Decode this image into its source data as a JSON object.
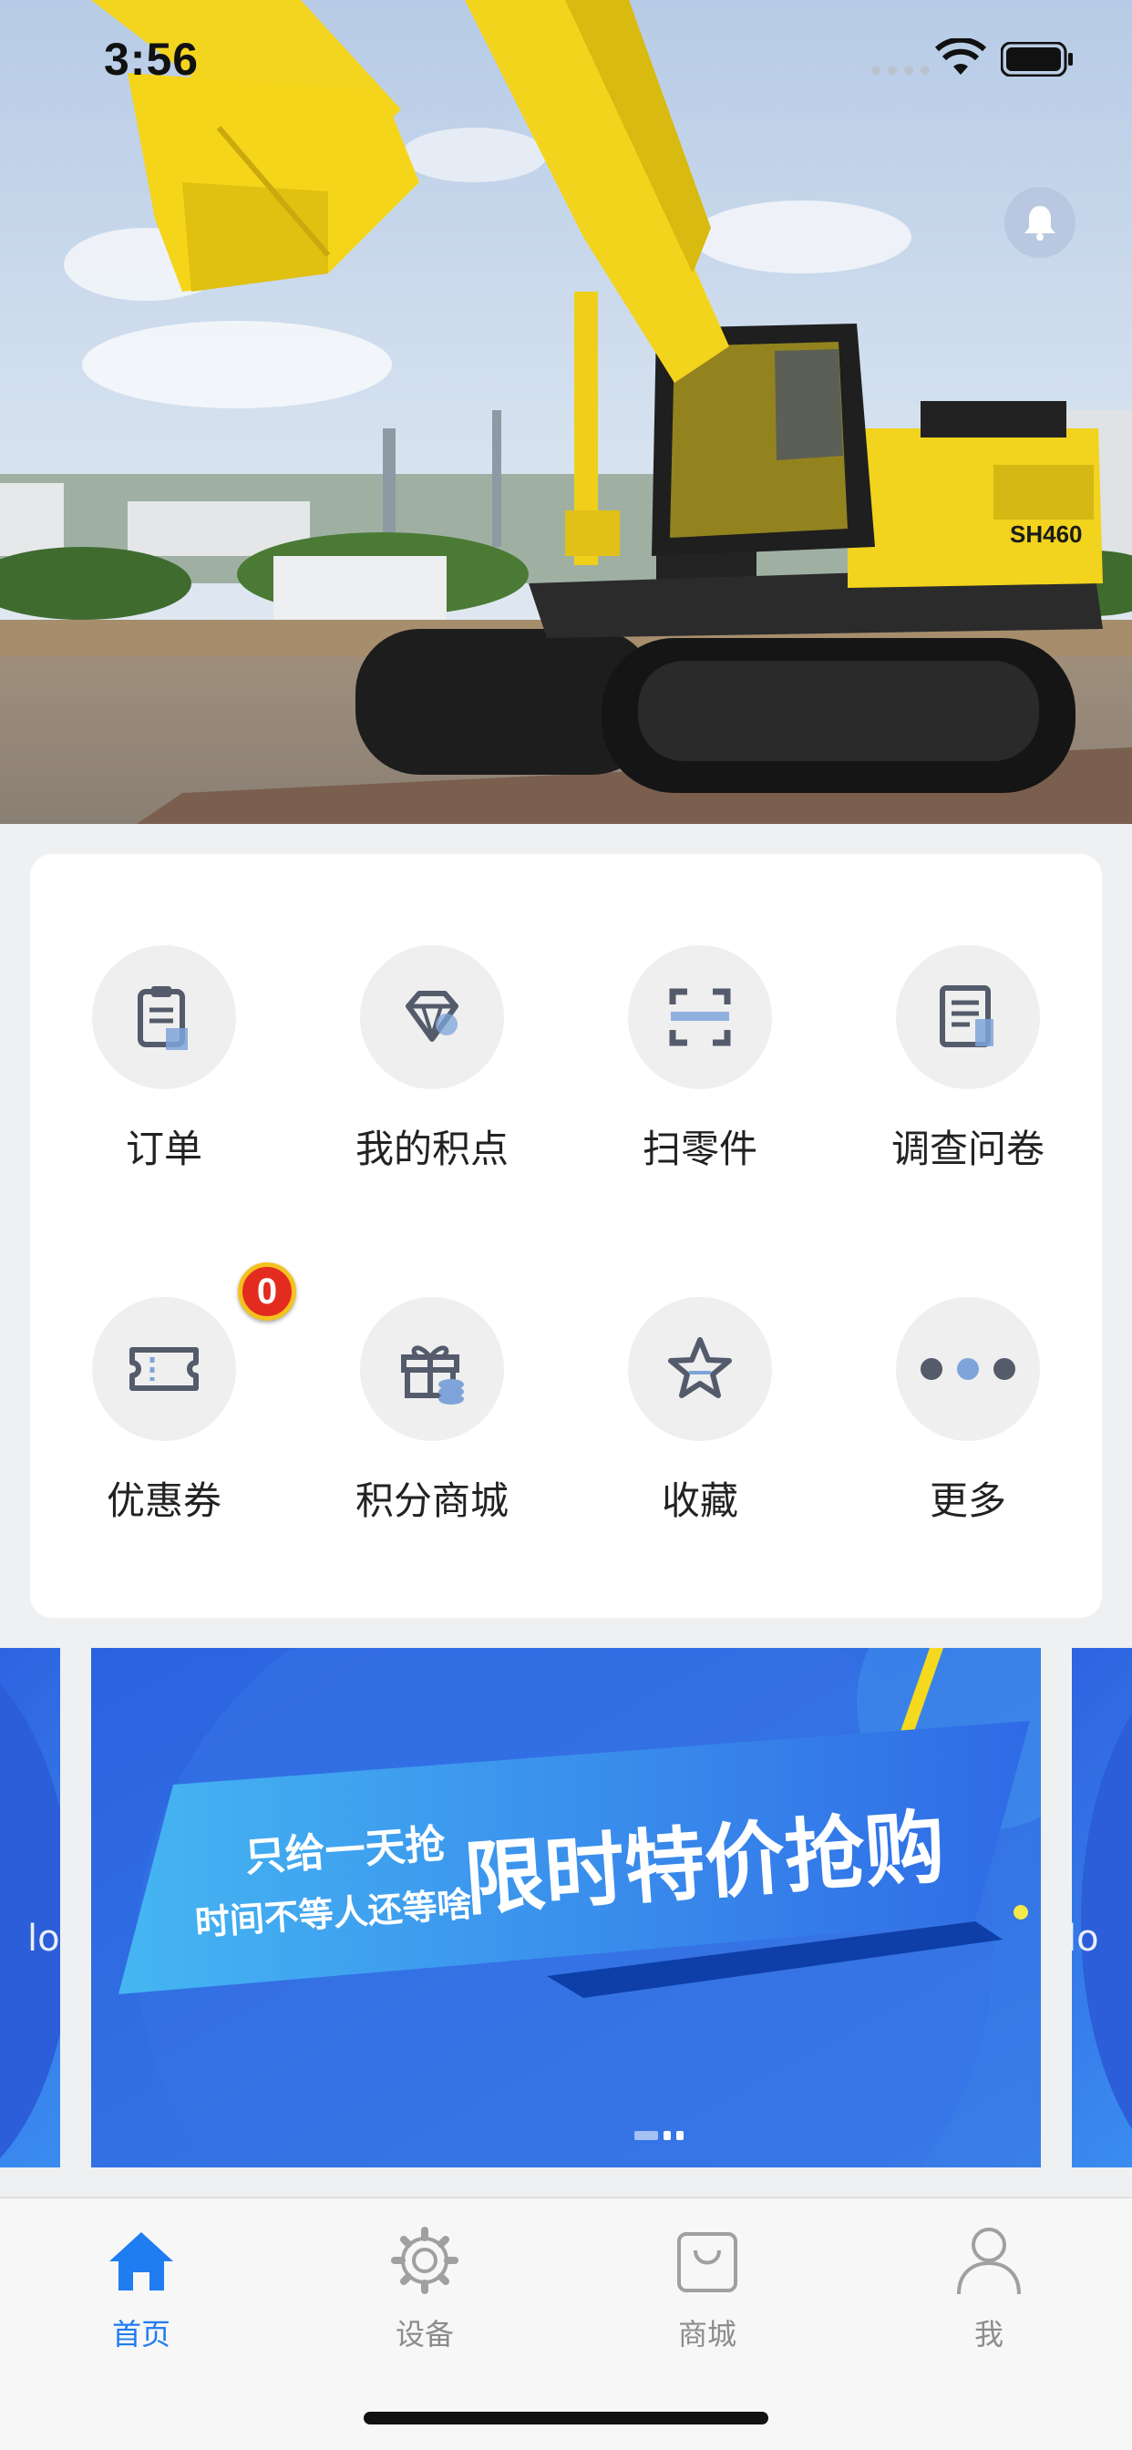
{
  "status_bar": {
    "time": "3:56"
  },
  "header": {
    "bell_icon": "bell-icon"
  },
  "menu": {
    "items": [
      {
        "label": "订单",
        "icon": "order-clipboard-icon"
      },
      {
        "label": "我的积点",
        "icon": "diamond-icon"
      },
      {
        "label": "扫零件",
        "icon": "scan-icon"
      },
      {
        "label": "调查问卷",
        "icon": "questionnaire-icon"
      },
      {
        "label": "优惠券",
        "icon": "coupon-ticket-icon",
        "badge": "0"
      },
      {
        "label": "积分商城",
        "icon": "gift-icon"
      },
      {
        "label": "收藏",
        "icon": "star-icon"
      },
      {
        "label": "更多",
        "icon": "more-dots-icon"
      }
    ]
  },
  "banner": {
    "line1": "只给一天抢",
    "line2": "时间不等人还等啥",
    "headline": "限时特价抢购",
    "accent_color": "#2f63e0"
  },
  "tabbar": {
    "tabs": [
      {
        "label": "首页",
        "icon": "home-icon",
        "active": true
      },
      {
        "label": "设备",
        "icon": "gear-icon",
        "active": false
      },
      {
        "label": "商城",
        "icon": "shopping-bag-icon",
        "active": false
      },
      {
        "label": "我",
        "icon": "person-icon",
        "active": false
      }
    ],
    "active_color": "#1f7cf1",
    "inactive_color": "#8c8c8c"
  }
}
